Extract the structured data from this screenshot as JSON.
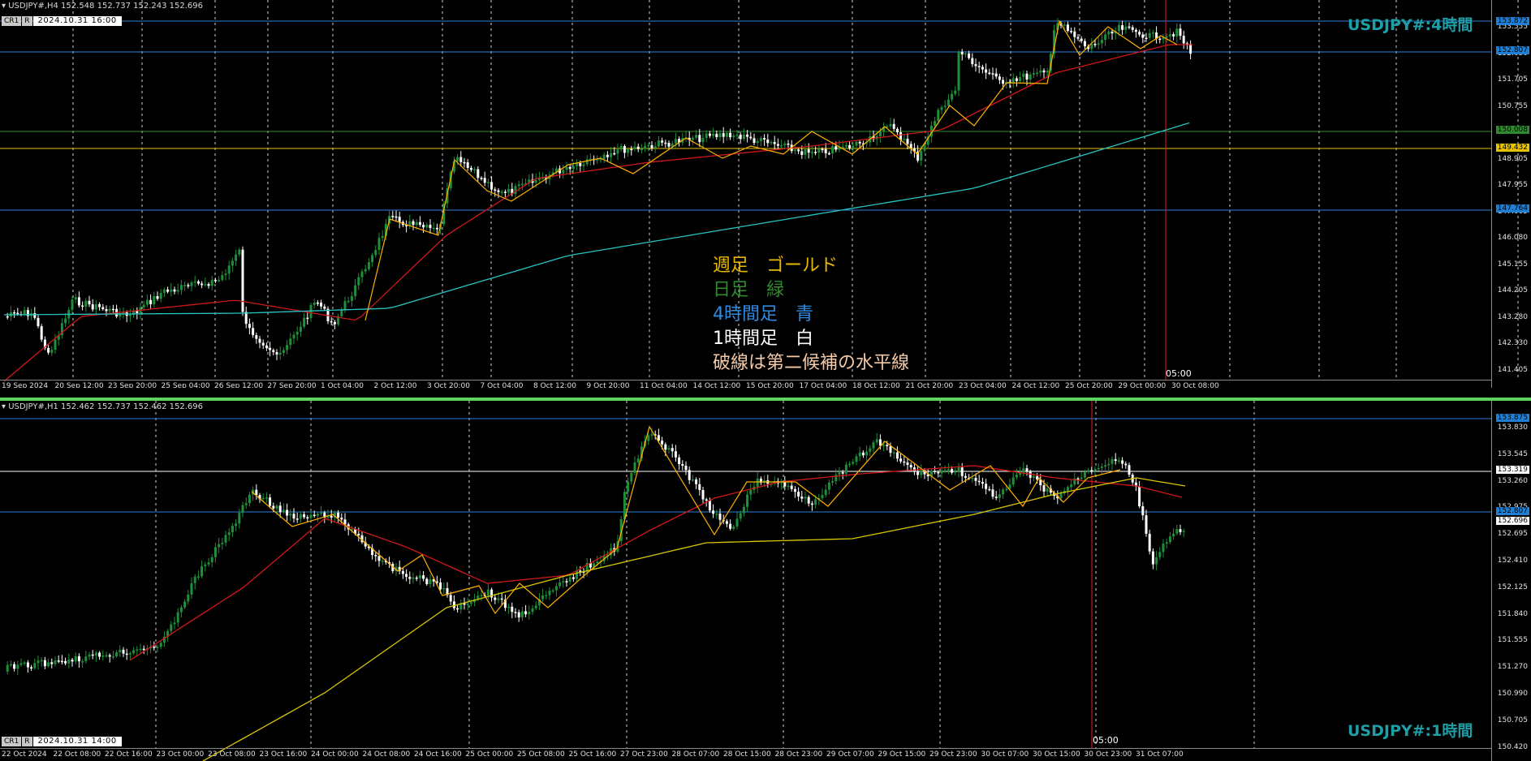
{
  "top_chart": {
    "symbol_line": "USDJPY#,H4  152.548 152.737 152.243 152.696",
    "tab_labels": [
      "CR1",
      "R"
    ],
    "date_box": "2024.10.31 16:00",
    "watermark": "USDJPY#:4時間",
    "time_marker": "05:00",
    "y_ticks": [
      "153.555",
      "152.630",
      "151.705",
      "150.755",
      "149.855",
      "148.905",
      "147.955",
      "147.005",
      "146.080",
      "145.155",
      "144.205",
      "143.280",
      "142.330",
      "141.405"
    ],
    "price_tags": [
      {
        "label": "153.872",
        "color": "#1f7fd6"
      },
      {
        "label": "152.807",
        "color": "#1f7fd6"
      },
      {
        "label": "150.008",
        "color": "#2e8b2e"
      },
      {
        "label": "149.432",
        "color": "#e6c200"
      },
      {
        "label": "147.764",
        "color": "#1f7fd6"
      }
    ],
    "x_ticks": [
      "19 Sep 2024",
      "20 Sep 12:00",
      "23 Sep 20:00",
      "25 Sep 04:00",
      "26 Sep 12:00",
      "27 Sep 20:00",
      "1 Oct 04:00",
      "2 Oct 12:00",
      "3 Oct 20:00",
      "7 Oct 04:00",
      "8 Oct 12:00",
      "9 Oct 20:00",
      "11 Oct 04:00",
      "14 Oct 12:00",
      "15 Oct 20:00",
      "17 Oct 04:00",
      "18 Oct 12:00",
      "21 Oct 20:00",
      "23 Oct 04:00",
      "24 Oct 12:00",
      "25 Oct 20:00",
      "29 Oct 00:00",
      "30 Oct 08:00"
    ]
  },
  "bottom_chart": {
    "symbol_line": "USDJPY#,H1  152.462 152.737 152.462 152.696",
    "tab_labels": [
      "CR1",
      "R"
    ],
    "date_box": "2024.10.31 14:00",
    "watermark": "USDJPY#:1時間",
    "time_marker": "05:00",
    "y_ticks": [
      "153.830",
      "153.545",
      "153.260",
      "152.975",
      "152.695",
      "152.410",
      "152.125",
      "151.840",
      "151.555",
      "151.270",
      "150.990",
      "150.705",
      "150.420"
    ],
    "price_tags": [
      {
        "label": "153.875",
        "color": "#1f7fd6"
      },
      {
        "label": "153.319",
        "color": "#ffffff"
      },
      {
        "label": "152.807",
        "color": "#1f7fd6"
      },
      {
        "label": "152.696",
        "color": "#ffffff"
      }
    ],
    "x_ticks": [
      "22 Oct 2024",
      "22 Oct 08:00",
      "22 Oct 16:00",
      "23 Oct 00:00",
      "23 Oct 08:00",
      "23 Oct 16:00",
      "24 Oct 00:00",
      "24 Oct 08:00",
      "24 Oct 16:00",
      "25 Oct 00:00",
      "25 Oct 08:00",
      "25 Oct 16:00",
      "27 Oct 23:00",
      "28 Oct 07:00",
      "28 Oct 15:00",
      "28 Oct 23:00",
      "29 Oct 07:00",
      "29 Oct 15:00",
      "29 Oct 23:00",
      "30 Oct 07:00",
      "30 Oct 15:00",
      "30 Oct 23:00",
      "31 Oct 07:00"
    ]
  },
  "legend": {
    "weekly": {
      "text": "週足　ゴールド",
      "color": "#e6b800"
    },
    "daily": {
      "text": "日足　緑",
      "color": "#2e8b2e"
    },
    "h4": {
      "text": "4時間足　青",
      "color": "#2f8be0"
    },
    "h1": {
      "text": "1時間足　白",
      "color": "#ffffff"
    },
    "note": {
      "text": "破線は第二候補の水平線",
      "color": "#f3c9a8"
    }
  },
  "colors": {
    "bull": "#1f8f3a",
    "bear": "#ffffff",
    "ma_red": "#d01818",
    "ma_cyan": "#27c4c4",
    "ma_yellow": "#d8c800",
    "zigzag": "#ffb000",
    "grid_dash": "#cfcfcf"
  }
}
